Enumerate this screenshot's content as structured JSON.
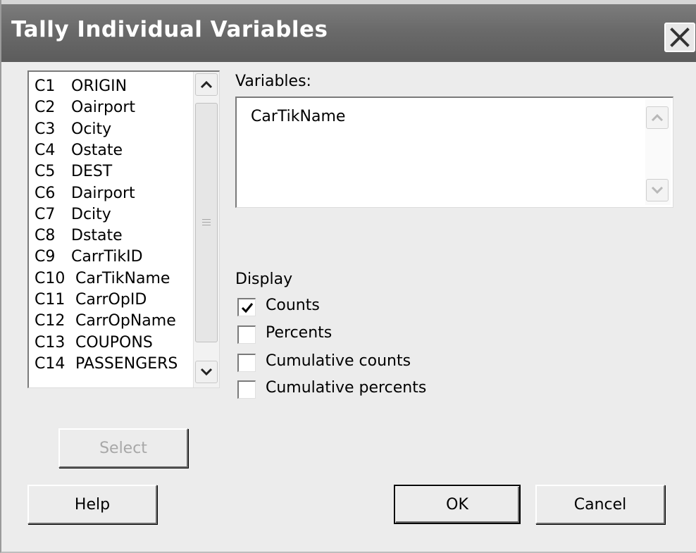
{
  "window": {
    "title": "Tally Individual Variables",
    "close_icon": "close-icon"
  },
  "columns_list": {
    "items": [
      {
        "col": "C1",
        "name": "ORIGIN"
      },
      {
        "col": "C2",
        "name": "Oairport"
      },
      {
        "col": "C3",
        "name": "Ocity"
      },
      {
        "col": "C4",
        "name": "Ostate"
      },
      {
        "col": "C5",
        "name": "DEST"
      },
      {
        "col": "C6",
        "name": "Dairport"
      },
      {
        "col": "C7",
        "name": "Dcity"
      },
      {
        "col": "C8",
        "name": "Dstate"
      },
      {
        "col": "C9",
        "name": "CarrTikID"
      },
      {
        "col": "C10",
        "name": "CarTikName"
      },
      {
        "col": "C11",
        "name": "CarrOpID"
      },
      {
        "col": "C12",
        "name": "CarrOpName"
      },
      {
        "col": "C13",
        "name": "COUPONS"
      },
      {
        "col": "C14",
        "name": "PASSENGERS"
      }
    ]
  },
  "variables": {
    "label": "Variables:",
    "value": "CarTikName"
  },
  "display": {
    "label": "Display",
    "options": [
      {
        "label": "Counts",
        "checked": true
      },
      {
        "label": "Percents",
        "checked": false
      },
      {
        "label": "Cumulative counts",
        "checked": false
      },
      {
        "label": "Cumulative percents",
        "checked": false
      }
    ]
  },
  "buttons": {
    "select": "Select",
    "help": "Help",
    "ok": "OK",
    "cancel": "Cancel"
  }
}
